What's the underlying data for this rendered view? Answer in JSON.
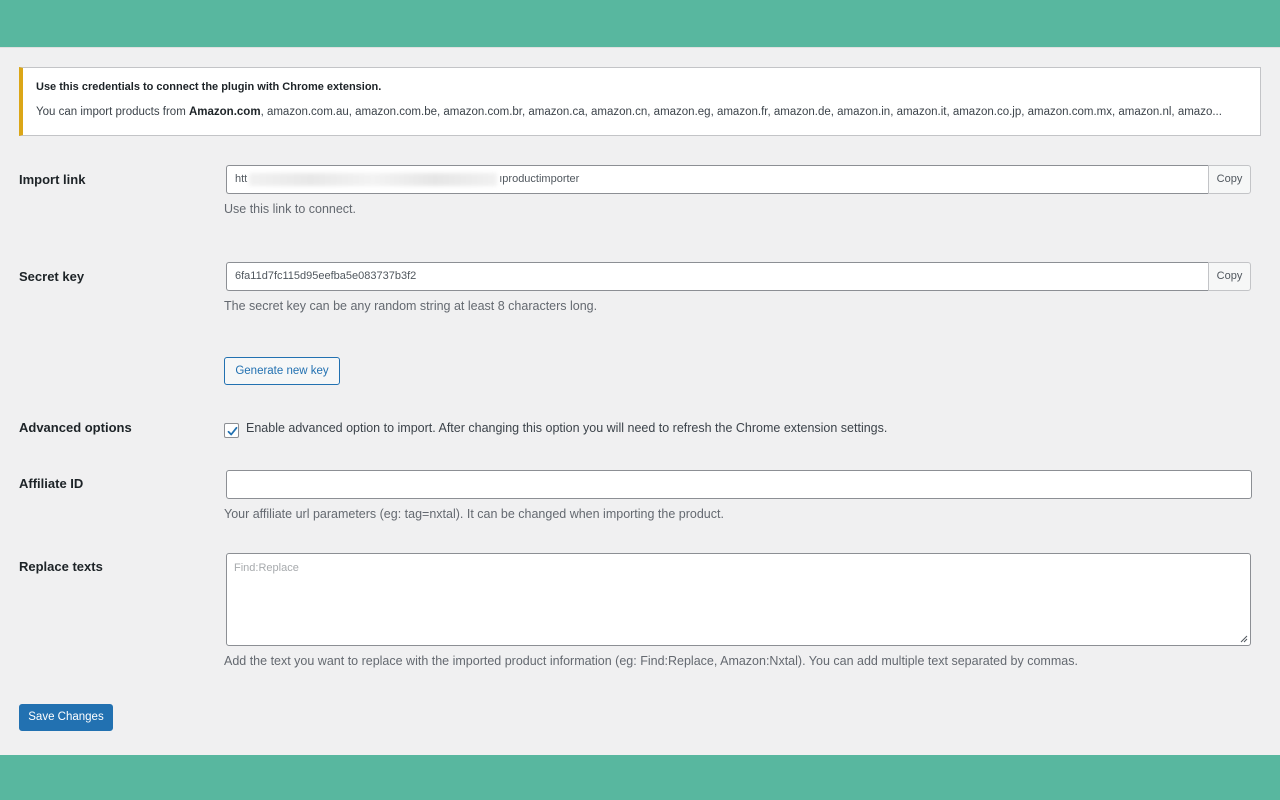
{
  "notice": {
    "title": "Use this credentials to connect the plugin with Chrome extension.",
    "text_prefix": "You can import products from ",
    "text_bold": "Amazon.com",
    "text_rest": ", amazon.com.au, amazon.com.be, amazon.com.br, amazon.ca, amazon.cn, amazon.eg, amazon.fr, amazon.de, amazon.in, amazon.it, amazon.co.jp, amazon.com.mx, amazon.nl, amazo..."
  },
  "import_link": {
    "label": "Import link",
    "value_start": "htt",
    "value_end": "ıproductimporter",
    "copy_label": "Copy",
    "description": "Use this link to connect."
  },
  "secret_key": {
    "label": "Secret key",
    "value": "6fa11d7fc115d95eefba5e083737b3f2",
    "copy_label": "Copy",
    "description": "The secret key can be any random string at least 8 characters long.",
    "generate_label": "Generate new key"
  },
  "advanced": {
    "label": "Advanced options",
    "checked": true,
    "checkbox_label": "Enable advanced option to import. After changing this option you will need to refresh the Chrome extension settings."
  },
  "affiliate": {
    "label": "Affiliate ID",
    "value": "",
    "description": "Your affiliate url parameters (eg: tag=nxtal). It can be changed when importing the product."
  },
  "replace_texts": {
    "label": "Replace texts",
    "placeholder": "Find:Replace",
    "description": "Add the text you want to replace with the imported product information (eg: Find:Replace, Amazon:Nxtal). You can add multiple text separated by commas."
  },
  "save_label": "Save Changes",
  "colors": {
    "brand_background": "#58b79f",
    "page_background": "#f0f0f1",
    "primary": "#2271b1",
    "notice_warning": "#dba617"
  }
}
